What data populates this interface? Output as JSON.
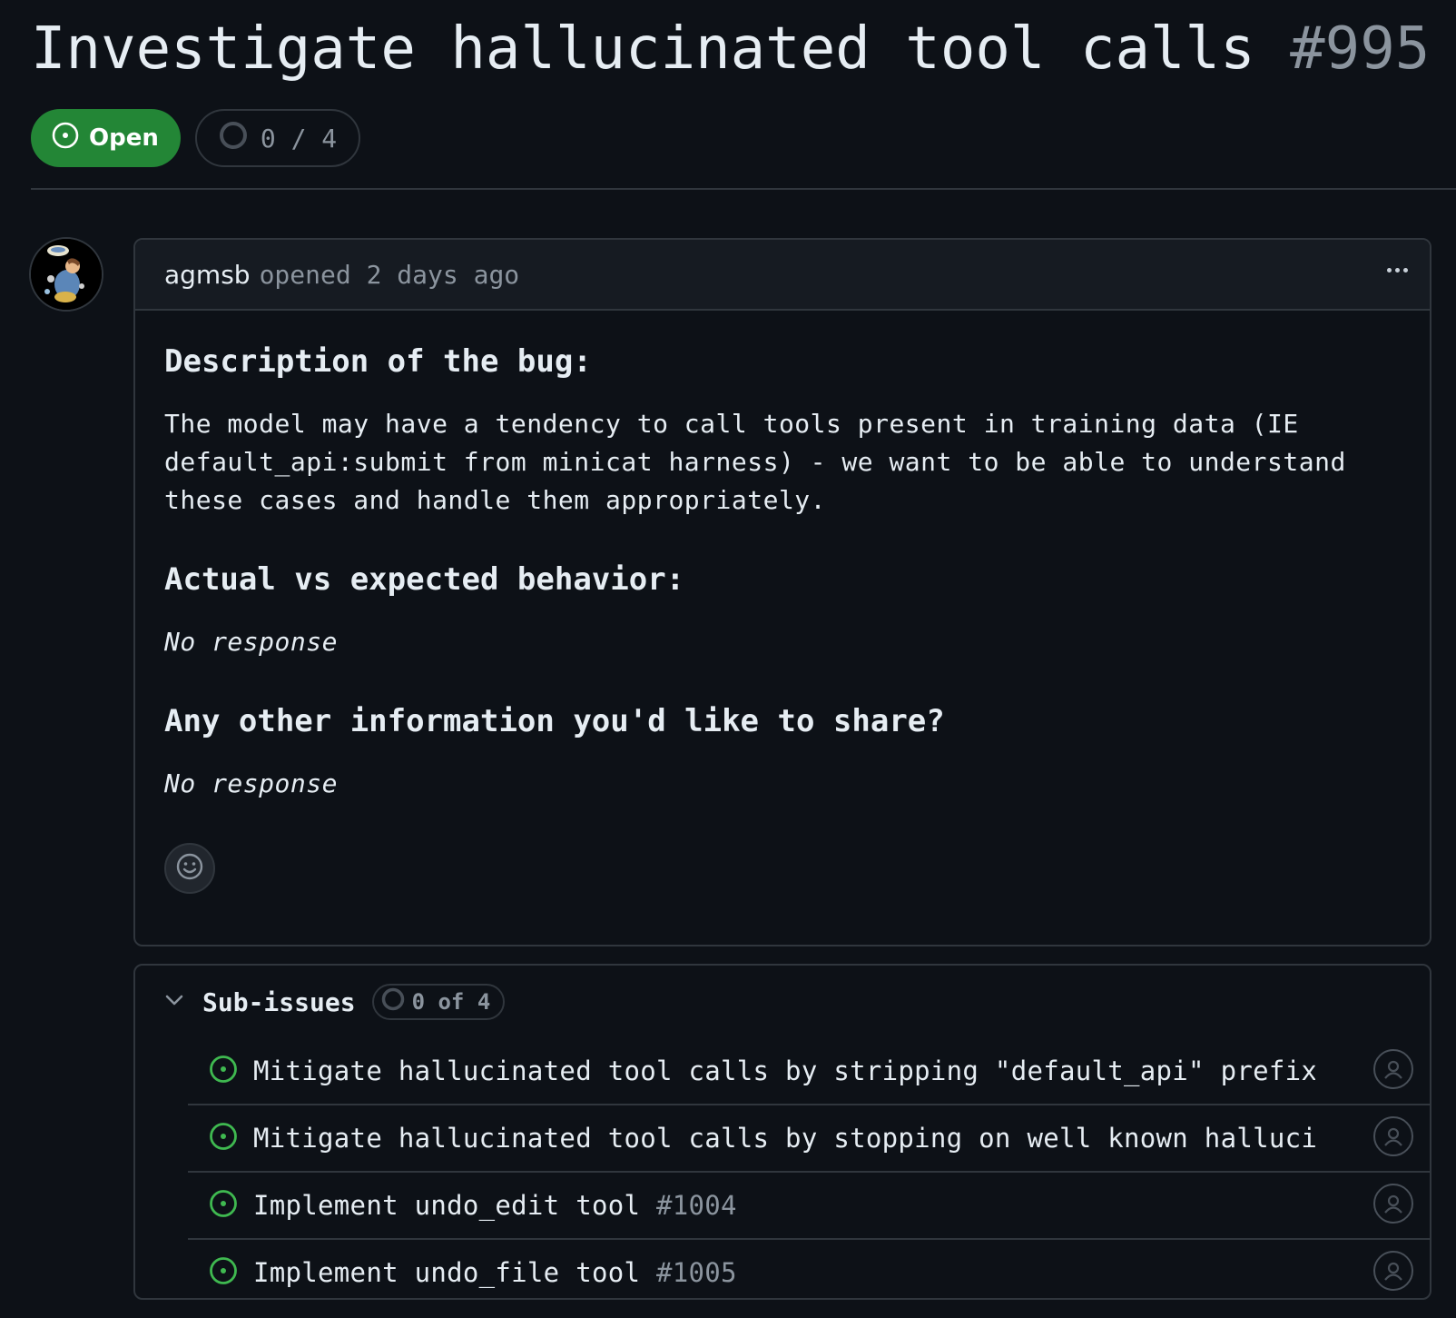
{
  "issue": {
    "title": "Investigate hallucinated tool calls",
    "number": "#995",
    "state_label": "Open",
    "progress": "0 / 4"
  },
  "comment": {
    "author": "agmsb",
    "meta": "opened 2 days ago",
    "sections": [
      {
        "heading": "Description of the bug:",
        "body": "The model may have a tendency to call tools present in training data (IE default_api:submit from minicat harness) - we want to be able to understand these cases and handle them appropriately."
      },
      {
        "heading": "Actual vs expected behavior:",
        "body": "No response"
      },
      {
        "heading": "Any other information you'd like to share?",
        "body": "No response"
      }
    ]
  },
  "subissues": {
    "label": "Sub-issues",
    "count": "0 of 4",
    "items": [
      {
        "title": "Mitigate hallucinated tool calls by stripping \"default_api\" prefix and",
        "number": ""
      },
      {
        "title": "Mitigate hallucinated tool calls by stopping on well known hallucinat",
        "number": ""
      },
      {
        "title": "Implement undo_edit tool",
        "number": "#1004"
      },
      {
        "title": "Implement undo_file tool",
        "number": "#1005"
      }
    ]
  },
  "colors": {
    "background": "#0d1117",
    "open_green": "#238636",
    "issue_icon_green": "#3fb950",
    "border": "#30363d",
    "muted_text": "#8b949e"
  },
  "icons": {
    "state": "issue-opened-icon",
    "progress": "progress-circle-icon",
    "more": "kebab-horizontal-icon",
    "reaction": "smiley-icon",
    "collapse": "chevron-down-icon",
    "item": "issue-opened-icon",
    "assignee": "person-icon"
  }
}
